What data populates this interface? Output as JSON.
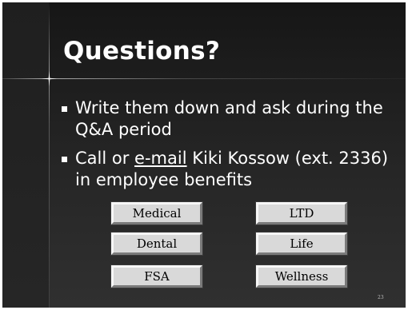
{
  "slide": {
    "title": "Questions?",
    "bullets": [
      {
        "lines": [
          "Write them down and ask during the",
          "Q&A period"
        ]
      },
      {
        "pre": "Call or ",
        "link": "e-mail",
        "post": " Kiki Kossow (ext. 2336)",
        "line2": "in employee benefits"
      }
    ],
    "buttons": [
      "Medical",
      "LTD",
      "Dental",
      "Life",
      "FSA",
      "Wellness"
    ],
    "slide_number": "23"
  },
  "colors": {
    "background": "#1c1c1c",
    "text": "#ffffff",
    "button_face": "#d9d9d9"
  }
}
